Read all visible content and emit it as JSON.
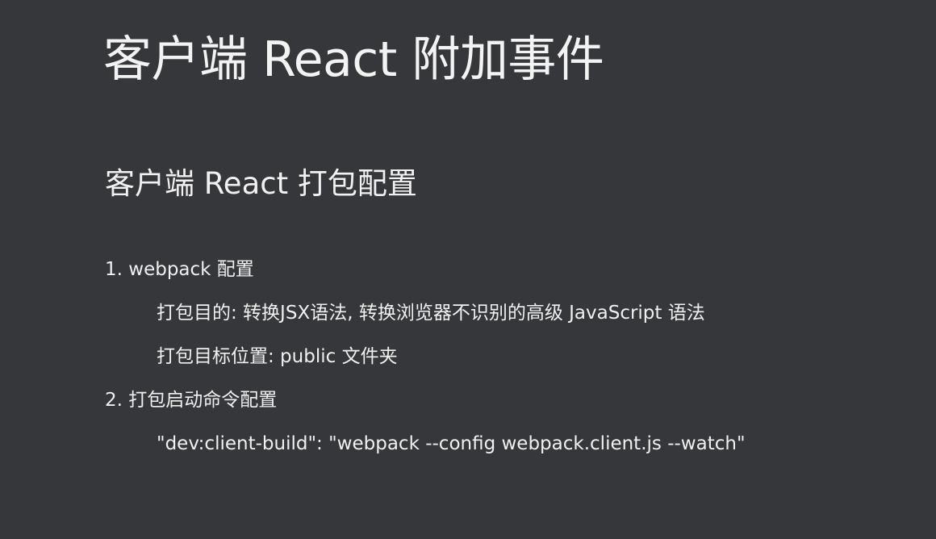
{
  "slide": {
    "title": "客户端 React 附加事件",
    "subtitle": "客户端 React 打包配置",
    "items": [
      {
        "text": "1. webpack 配置"
      },
      {
        "text": "打包目的: 转换JSX语法, 转换浏览器不识别的高级 JavaScript 语法"
      },
      {
        "text": "打包目标位置: public 文件夹"
      },
      {
        "text": "2. 打包启动命令配置"
      },
      {
        "text": "\"dev:client-build\": \"webpack --config webpack.client.js --watch\""
      }
    ]
  },
  "colors": {
    "background": "#36373a",
    "text": "#f1f1f1"
  }
}
